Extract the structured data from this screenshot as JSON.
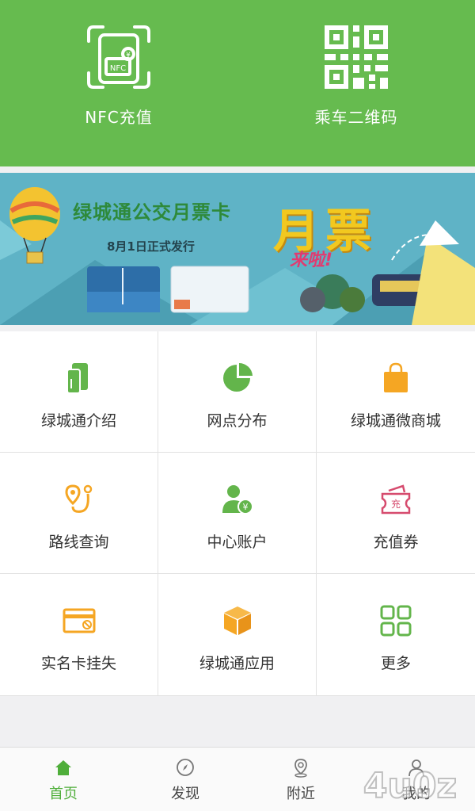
{
  "top_actions": {
    "nfc_label": "NFC充值",
    "qr_label": "乘车二维码",
    "nfc_badge": "NFC",
    "nfc_currency": "¥"
  },
  "banner": {
    "title": "绿城通公交月票卡",
    "subtitle": "8月1日正式发行",
    "big_text": "月票",
    "small_text": "来啦!"
  },
  "grid": {
    "items": [
      {
        "label": "绿城通介绍",
        "icon": "card-icon"
      },
      {
        "label": "网点分布",
        "icon": "pie-chart-icon"
      },
      {
        "label": "绿城通微商城",
        "icon": "shopping-bag-icon"
      },
      {
        "label": "路线查询",
        "icon": "route-icon"
      },
      {
        "label": "中心账户",
        "icon": "account-icon"
      },
      {
        "label": "充值券",
        "icon": "voucher-icon"
      },
      {
        "label": "实名卡挂失",
        "icon": "card-lost-icon"
      },
      {
        "label": "绿城通应用",
        "icon": "box-icon"
      },
      {
        "label": "更多",
        "icon": "more-grid-icon"
      }
    ],
    "voucher_char": "充",
    "account_currency": "¥"
  },
  "bottom_nav": {
    "tabs": [
      {
        "label": "首页",
        "icon": "home-icon",
        "active": true
      },
      {
        "label": "发现",
        "icon": "compass-icon",
        "active": false
      },
      {
        "label": "附近",
        "icon": "location-icon",
        "active": false
      },
      {
        "label": "我的",
        "icon": "user-icon",
        "active": false
      }
    ]
  },
  "watermark": "4u0z",
  "colors": {
    "primary_green": "#66bb4f",
    "accent_orange": "#f5a623",
    "accent_red": "#d64b6e"
  }
}
